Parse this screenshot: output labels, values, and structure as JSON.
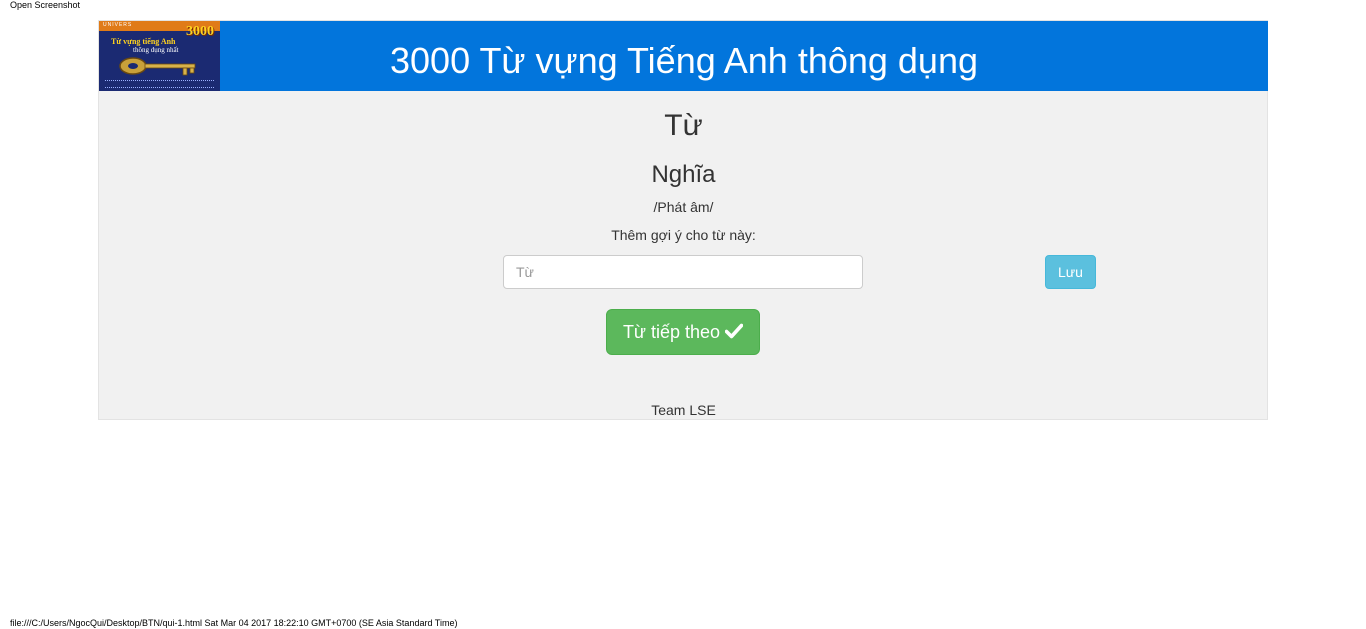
{
  "print": {
    "header": "Open Screenshot",
    "footer": "file:///C:/Users/NgocQui/Desktop/BTN/qui-1.html Sat Mar 04 2017 18:22:10 GMT+0700 (SE Asia Standard Time)"
  },
  "banner": {
    "title": "3000 Từ vựng Tiếng Anh thông dụng",
    "cover": {
      "brand": "UNIVERS",
      "number": "3000",
      "line1": "Từ vựng tiếng Anh",
      "line2": "thông dụng nhất"
    },
    "color": "#0275dc"
  },
  "card": {
    "word": "Từ",
    "meaning": "Nghĩa",
    "phonetic": "/Phát âm/",
    "hint_label": "Thêm gợi ý cho từ này:",
    "hint_placeholder": "Từ",
    "hint_value": "",
    "save_label": "Lưu",
    "next_label": "Từ tiếp theo",
    "next_icon": "check-icon"
  },
  "footer": {
    "team": "Team LSE"
  },
  "colors": {
    "info_button": "#5bc0de",
    "success_button": "#5cb85c",
    "panel_background": "#f1f1f1"
  }
}
